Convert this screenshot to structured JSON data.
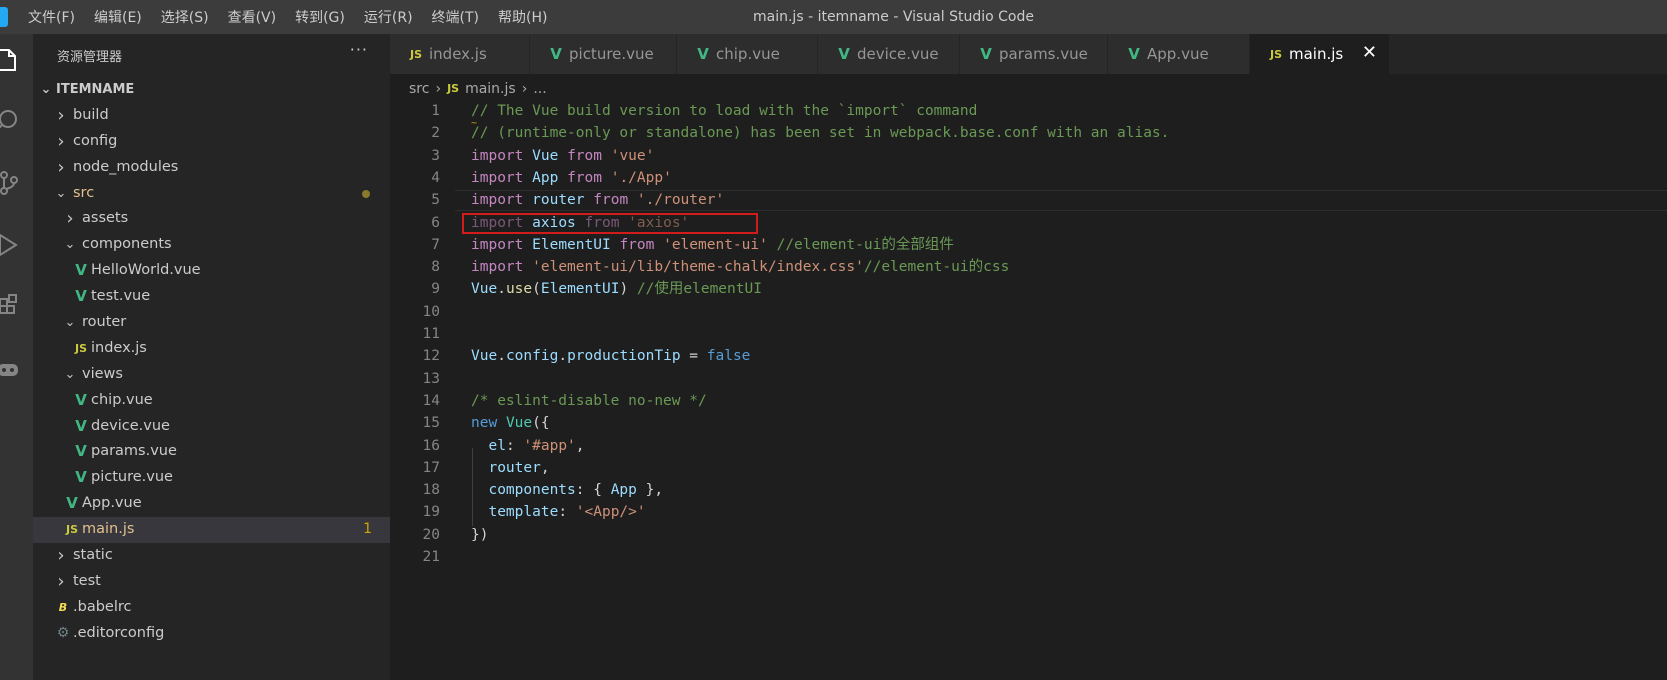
{
  "window_title": "main.js - itemname - Visual Studio Code",
  "menu": [
    "文件(F)",
    "编辑(E)",
    "选择(S)",
    "查看(V)",
    "转到(G)",
    "运行(R)",
    "终端(T)",
    "帮助(H)"
  ],
  "sidebar": {
    "title": "资源管理器",
    "more": "···",
    "project": "ITEMNAME",
    "items": [
      {
        "label": "build",
        "type": "folder",
        "open": false
      },
      {
        "label": "config",
        "type": "folder",
        "open": false
      },
      {
        "label": "node_modules",
        "type": "folder",
        "open": false
      },
      {
        "label": "src",
        "type": "folder",
        "open": true
      },
      {
        "label": "assets",
        "type": "folder",
        "open": false
      },
      {
        "label": "components",
        "type": "folder",
        "open": true
      },
      {
        "label": "HelloWorld.vue",
        "type": "vue"
      },
      {
        "label": "test.vue",
        "type": "vue"
      },
      {
        "label": "router",
        "type": "folder",
        "open": true
      },
      {
        "label": "index.js",
        "type": "js"
      },
      {
        "label": "views",
        "type": "folder",
        "open": true
      },
      {
        "label": "chip.vue",
        "type": "vue"
      },
      {
        "label": "device.vue",
        "type": "vue"
      },
      {
        "label": "params.vue",
        "type": "vue"
      },
      {
        "label": "picture.vue",
        "type": "vue"
      },
      {
        "label": "App.vue",
        "type": "vue"
      },
      {
        "label": "main.js",
        "type": "js",
        "badge": "1"
      },
      {
        "label": "static",
        "type": "folder",
        "open": false
      },
      {
        "label": "test",
        "type": "folder",
        "open": false
      },
      {
        "label": ".babelrc",
        "type": "babel"
      },
      {
        "label": ".editorconfig",
        "type": "gear"
      }
    ]
  },
  "tabs": [
    {
      "label": "index.js",
      "type": "js"
    },
    {
      "label": "picture.vue",
      "type": "vue"
    },
    {
      "label": "chip.vue",
      "type": "vue"
    },
    {
      "label": "device.vue",
      "type": "vue"
    },
    {
      "label": "params.vue",
      "type": "vue"
    },
    {
      "label": "App.vue",
      "type": "vue"
    },
    {
      "label": "main.js",
      "type": "js",
      "active": true,
      "close": "✕"
    }
  ],
  "breadcrumb": {
    "folder": "src",
    "file": "main.js",
    "more": "..."
  },
  "icons": {
    "vue": "V",
    "js": "JS",
    "babel": "B",
    "gear": "⚙"
  },
  "colors": {
    "highlight_box": "#d21b1b",
    "badge": "#cca700"
  },
  "editor": {
    "lines": [
      {
        "n": "1",
        "parts": [
          [
            "c",
            "// The Vue build version to load with the `import` command"
          ]
        ]
      },
      {
        "n": "2",
        "parts": [
          [
            "c",
            "// (runtime-only or standalone) has been set in webpack.base.conf with an alias."
          ]
        ]
      },
      {
        "n": "3",
        "parts": [
          [
            "kw",
            "import"
          ],
          [
            "p",
            " "
          ],
          [
            "v",
            "Vue"
          ],
          [
            "p",
            " "
          ],
          [
            "kw",
            "from"
          ],
          [
            "p",
            " "
          ],
          [
            "s",
            "'vue'"
          ]
        ]
      },
      {
        "n": "4",
        "parts": [
          [
            "kw",
            "import"
          ],
          [
            "p",
            " "
          ],
          [
            "v",
            "App"
          ],
          [
            "p",
            " "
          ],
          [
            "kw",
            "from"
          ],
          [
            "p",
            " "
          ],
          [
            "s",
            "'./App'"
          ]
        ]
      },
      {
        "n": "5",
        "parts": [
          [
            "kw",
            "import"
          ],
          [
            "p",
            " "
          ],
          [
            "v",
            "router"
          ],
          [
            "p",
            " "
          ],
          [
            "kw",
            "from"
          ],
          [
            "p",
            " "
          ],
          [
            "s",
            "'./router'"
          ]
        ]
      },
      {
        "n": "6",
        "parts": [
          [
            "kw dim",
            "import"
          ],
          [
            "p",
            " "
          ],
          [
            "v",
            "axios"
          ],
          [
            "p",
            " "
          ],
          [
            "kw dim",
            "from"
          ],
          [
            "p",
            " "
          ],
          [
            "s dim",
            "'axios'"
          ]
        ]
      },
      {
        "n": "7",
        "parts": [
          [
            "kw",
            "import"
          ],
          [
            "p",
            " "
          ],
          [
            "v",
            "ElementUI"
          ],
          [
            "p",
            " "
          ],
          [
            "kw",
            "from"
          ],
          [
            "p",
            " "
          ],
          [
            "s",
            "'element-ui'"
          ],
          [
            "p",
            " "
          ],
          [
            "c",
            "//element-ui的全部组件"
          ]
        ]
      },
      {
        "n": "8",
        "parts": [
          [
            "kw",
            "import"
          ],
          [
            "p",
            " "
          ],
          [
            "s",
            "'element-ui/lib/theme-chalk/index.css'"
          ],
          [
            "c",
            "//element-ui的css"
          ]
        ]
      },
      {
        "n": "9",
        "parts": [
          [
            "v",
            "Vue"
          ],
          [
            "p",
            "."
          ],
          [
            "f",
            "use"
          ],
          [
            "p",
            "("
          ],
          [
            "v",
            "ElementUI"
          ],
          [
            "p",
            ") "
          ],
          [
            "c",
            "//使用elementUI"
          ]
        ]
      },
      {
        "n": "10",
        "parts": []
      },
      {
        "n": "11",
        "parts": []
      },
      {
        "n": "12",
        "parts": [
          [
            "v",
            "Vue"
          ],
          [
            "p",
            "."
          ],
          [
            "v",
            "config"
          ],
          [
            "p",
            "."
          ],
          [
            "v",
            "productionTip"
          ],
          [
            "p",
            " = "
          ],
          [
            "k",
            "false"
          ]
        ]
      },
      {
        "n": "13",
        "parts": []
      },
      {
        "n": "14",
        "parts": [
          [
            "c",
            "/* eslint-disable no-new */"
          ]
        ]
      },
      {
        "n": "15",
        "parts": [
          [
            "k",
            "new"
          ],
          [
            "p",
            " "
          ],
          [
            "t",
            "Vue"
          ],
          [
            "p",
            "({"
          ]
        ]
      },
      {
        "n": "16",
        "parts": [
          [
            "p",
            "  "
          ],
          [
            "v",
            "el"
          ],
          [
            "p",
            ": "
          ],
          [
            "s",
            "'#app'"
          ],
          [
            "p",
            ","
          ]
        ]
      },
      {
        "n": "17",
        "parts": [
          [
            "p",
            "  "
          ],
          [
            "v",
            "router"
          ],
          [
            "p",
            ","
          ]
        ]
      },
      {
        "n": "18",
        "parts": [
          [
            "p",
            "  "
          ],
          [
            "v",
            "components"
          ],
          [
            "p",
            ": { "
          ],
          [
            "v",
            "App"
          ],
          [
            "p",
            " },"
          ]
        ]
      },
      {
        "n": "19",
        "parts": [
          [
            "p",
            "  "
          ],
          [
            "v",
            "template"
          ],
          [
            "p",
            ": "
          ],
          [
            "s",
            "'<App/>'"
          ]
        ]
      },
      {
        "n": "20",
        "parts": [
          [
            "p",
            "})"
          ]
        ]
      },
      {
        "n": "21",
        "parts": []
      }
    ]
  }
}
